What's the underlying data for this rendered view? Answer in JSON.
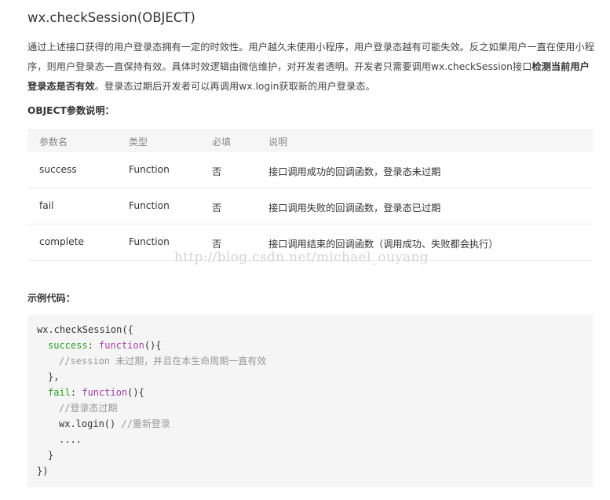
{
  "doc": {
    "title": "wx.checkSession(OBJECT)",
    "paragraph_parts": [
      "通过上述接口获得的用户登录态拥有一定的时效性。用户越久未使用小程序，用户登录态越有可能失效。反之如果用户一直在使用小程序，则用户登录态一直保持有效。具体时效逻辑由微信维护，对开发者透明。开发者只需要调用wx.checkSession接口",
      "检测当前用户登录态是否有效",
      "。登录态过期后开发者可以再调用wx.login获取新的用户登录态。"
    ],
    "params_heading": "OBJECT参数说明：",
    "example_heading": "示例代码：",
    "watermark": "http://blog.csdn.net/michael_ouyang"
  },
  "params_table": {
    "headers": [
      "参数名",
      "类型",
      "必填",
      "说明"
    ],
    "rows": [
      {
        "name": "success",
        "type": "Function",
        "required": "否",
        "desc": "接口调用成功的回调函数，登录态未过期"
      },
      {
        "name": "fail",
        "type": "Function",
        "required": "否",
        "desc": "接口调用失败的回调函数，登录态已过期"
      },
      {
        "name": "complete",
        "type": "Function",
        "required": "否",
        "desc": "接口调用结束的回调函数（调用成功、失败都会执行）"
      }
    ]
  },
  "code": {
    "l1": "wx.checkSession({",
    "l2_prop": "success",
    "l2_colon": ": ",
    "l2_kw": "function",
    "l2_rest": "(){",
    "l3": "//session 未过期，并且在本生命周期一直有效",
    "l4": "},",
    "l5_prop": "fail",
    "l5_colon": ": ",
    "l5_kw": "function",
    "l5_rest": "(){",
    "l6": "//登录态过期",
    "l7_code": "wx.login()",
    "l7_comment": " //重新登录",
    "l8": "....",
    "l9": "}",
    "l10": "})"
  },
  "colors": {
    "code_function_keyword": "#a442a4",
    "code_property": "#2a9d2a",
    "code_comment": "#999999",
    "table_header_bg": "#f6f6f6",
    "code_bg": "#f5f5f5"
  }
}
